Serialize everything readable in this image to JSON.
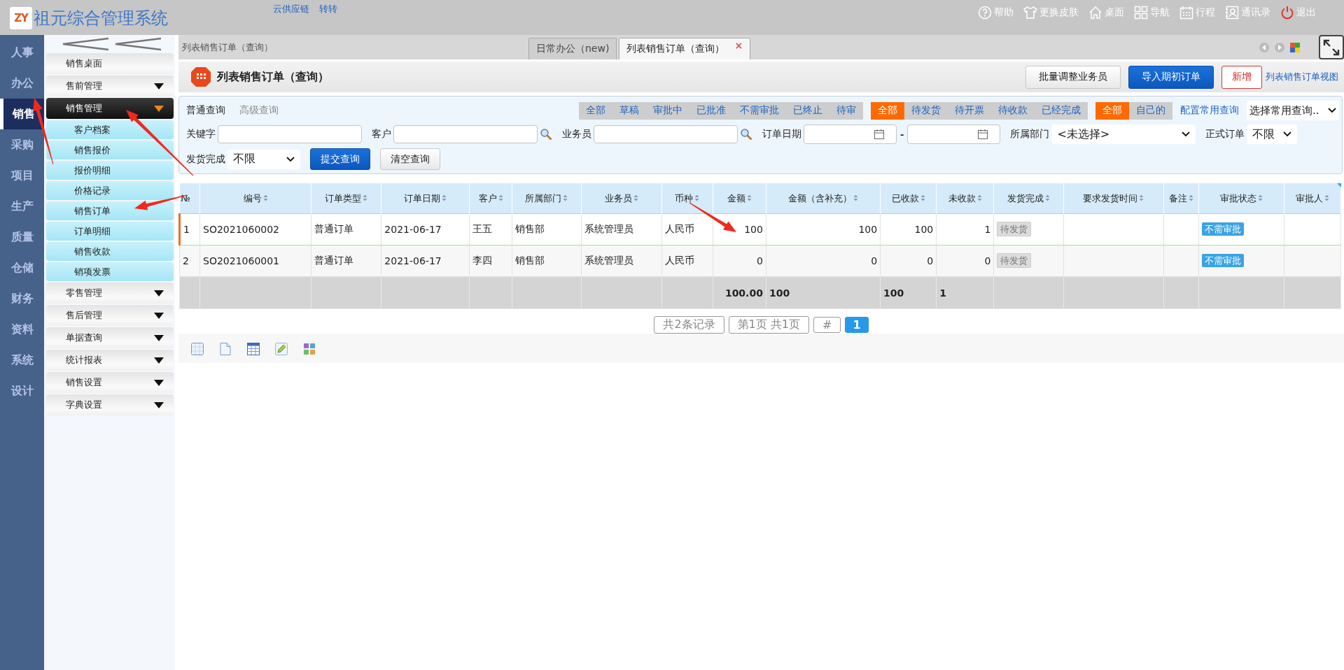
{
  "header": {
    "logo_mark": "ZY",
    "app_title": "祖元综合管理系统",
    "top_links": [
      "云供应链",
      "转转"
    ],
    "actions": [
      {
        "kind": "help",
        "label": "帮助"
      },
      {
        "kind": "shirt",
        "label": "更换皮肤"
      },
      {
        "kind": "home",
        "label": "桌面"
      },
      {
        "kind": "grid",
        "label": "导航"
      },
      {
        "kind": "calendar",
        "label": "行程"
      },
      {
        "kind": "contacts",
        "label": "通讯录"
      },
      {
        "kind": "power",
        "label": "退出"
      }
    ]
  },
  "module_nav": [
    {
      "label": "人事",
      "selected": false
    },
    {
      "label": "办公",
      "selected": false
    },
    {
      "label": "销售",
      "selected": true
    },
    {
      "label": "采购",
      "selected": false
    },
    {
      "label": "项目",
      "selected": false
    },
    {
      "label": "生产",
      "selected": false
    },
    {
      "label": "质量",
      "selected": false
    },
    {
      "label": "仓储",
      "selected": false
    },
    {
      "label": "财务",
      "selected": false
    },
    {
      "label": "资料",
      "selected": false
    },
    {
      "label": "系统",
      "selected": false
    },
    {
      "label": "设计",
      "selected": false
    }
  ],
  "sidebar": {
    "items": [
      {
        "kind": "link",
        "label": "销售桌面"
      },
      {
        "kind": "group",
        "label": "售前管理",
        "expanded": false
      },
      {
        "kind": "group",
        "label": "销售管理",
        "expanded": true,
        "children": [
          {
            "label": "客户档案"
          },
          {
            "label": "销售报价"
          },
          {
            "label": "报价明细"
          },
          {
            "label": "价格记录"
          },
          {
            "label": "销售订单"
          },
          {
            "label": "订单明细"
          },
          {
            "label": "销售收款"
          },
          {
            "label": "销项发票"
          }
        ]
      },
      {
        "kind": "group",
        "label": "零售管理",
        "expanded": false
      },
      {
        "kind": "group",
        "label": "售后管理",
        "expanded": false
      },
      {
        "kind": "group",
        "label": "单据查询",
        "expanded": false
      },
      {
        "kind": "group",
        "label": "统计报表",
        "expanded": false
      },
      {
        "kind": "group",
        "label": "销售设置",
        "expanded": false
      },
      {
        "kind": "group",
        "label": "字典设置",
        "expanded": false
      }
    ]
  },
  "breadcrumb": "列表销售订单（查询）",
  "tabs": [
    {
      "label": "日常办公（new)",
      "selected": false
    },
    {
      "label": "列表销售订单（查询）",
      "selected": true,
      "close_glyph": "×"
    }
  ],
  "page_header": {
    "title": "列表销售订单（查询）",
    "buttons": [
      {
        "kind": "default",
        "label": "批量调整业务员"
      },
      {
        "kind": "primary",
        "label": "导入期初订单"
      },
      {
        "kind": "danger",
        "label": "新增"
      }
    ],
    "link": "列表销售订单视图"
  },
  "query": {
    "modes": [
      {
        "label": "普通查询",
        "selected": true
      },
      {
        "label": "高级查询",
        "selected": false
      }
    ],
    "filter_groups": [
      [
        {
          "label": "全部",
          "selected": false
        },
        {
          "label": "草稿",
          "selected": false
        },
        {
          "label": "审批中",
          "selected": false
        },
        {
          "label": "已批准",
          "selected": false
        },
        {
          "label": "不需审批",
          "selected": false
        },
        {
          "label": "已终止",
          "selected": false
        },
        {
          "label": "待审",
          "selected": false
        }
      ],
      [
        {
          "label": "全部",
          "selected": true
        },
        {
          "label": "待发货",
          "selected": false
        },
        {
          "label": "待开票",
          "selected": false
        },
        {
          "label": "待收款",
          "selected": false
        },
        {
          "label": "已经完成",
          "selected": false
        }
      ],
      [
        {
          "label": "全部",
          "selected": true
        },
        {
          "label": "自己的",
          "selected": false
        }
      ]
    ],
    "config_link": "配置常用查询",
    "saved_query": "选择常用查询..",
    "fields": [
      {
        "kind": "text",
        "label": "关键字"
      },
      {
        "kind": "lookup",
        "label": "客户"
      },
      {
        "kind": "lookup",
        "label": "业务员"
      },
      {
        "kind": "daterange",
        "label": "订单日期",
        "separator": "-"
      },
      {
        "kind": "select",
        "label": "所属部门",
        "value": "<未选择>"
      },
      {
        "kind": "select",
        "label": "正式订单",
        "value": "不限"
      },
      {
        "kind": "select",
        "label": "发货完成",
        "value": "不限"
      }
    ],
    "buttons": [
      {
        "kind": "primary",
        "label": "提交查询"
      },
      {
        "kind": "default",
        "label": "清空查询"
      }
    ]
  },
  "table": {
    "columns": [
      {
        "label": "№",
        "sortable": false
      },
      {
        "label": "编号",
        "sortable": true
      },
      {
        "label": "订单类型",
        "sortable": true
      },
      {
        "label": "订单日期",
        "sortable": true
      },
      {
        "label": "客户",
        "sortable": true
      },
      {
        "label": "所属部门",
        "sortable": true
      },
      {
        "label": "业务员",
        "sortable": true
      },
      {
        "label": "币种",
        "sortable": true
      },
      {
        "label": "金额",
        "sortable": true
      },
      {
        "label": "金额（含补充）",
        "sortable": true
      },
      {
        "label": "已收款",
        "sortable": true
      },
      {
        "label": "未收款",
        "sortable": true
      },
      {
        "label": "发货完成",
        "sortable": true
      },
      {
        "label": "要求发货时间",
        "sortable": true
      },
      {
        "label": "备注",
        "sortable": true
      },
      {
        "label": "审批状态",
        "sortable": true
      },
      {
        "label": "审批人",
        "sortable": true
      }
    ],
    "rows": [
      {
        "selected": true,
        "cells": [
          "1",
          "SO2021060002",
          "普通订单",
          "2021-06-17",
          "王五",
          "销售部",
          "系统管理员",
          "人民币",
          "100",
          "100",
          "100",
          "1"
        ],
        "ship_status": "待发货",
        "approval": "不需审批"
      },
      {
        "selected": false,
        "cells": [
          "2",
          "SO2021060001",
          "普通订单",
          "2021-06-17",
          "李四",
          "销售部",
          "系统管理员",
          "人民币",
          "0",
          "0",
          "0",
          "0"
        ],
        "ship_status": "待发货",
        "approval": "不需审批"
      }
    ],
    "totals": {
      "amount": "100.00",
      "amount_with_extra": "100",
      "received": "100",
      "unreceived": "1"
    }
  },
  "pagination": {
    "summary": "共2条记录",
    "page_info": "第1页 共1页",
    "jump": "#",
    "pages": [
      {
        "label": "1",
        "selected": true
      }
    ]
  },
  "toolbar_icons": [
    {
      "kind": "dotted-grid"
    },
    {
      "kind": "page"
    },
    {
      "kind": "table"
    },
    {
      "kind": "pencil"
    },
    {
      "kind": "puzzle"
    }
  ],
  "annotation_arrows": [
    {
      "kind": "arrow"
    },
    {
      "kind": "arrow"
    },
    {
      "kind": "arrow"
    },
    {
      "kind": "arrow"
    }
  ]
}
